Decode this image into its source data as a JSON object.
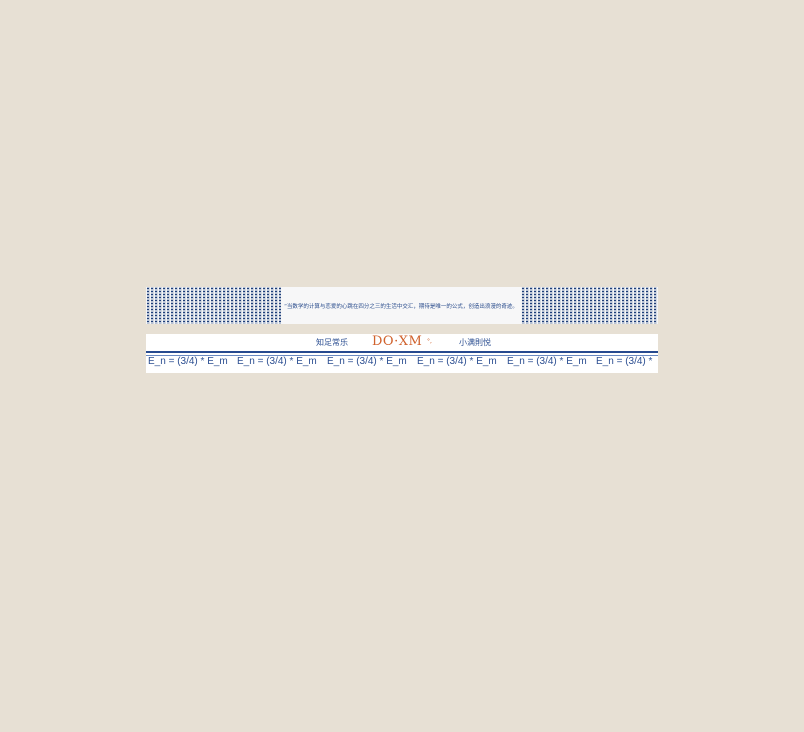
{
  "banner": {
    "quote": "“当数学的计算与恋爱的心跳在四分之三的生活中交汇，期待是唯一的公式，创造出浪漫的奇迹。"
  },
  "header": {
    "slogan_left": "知足常乐",
    "logo": "DO·XM",
    "logo_mark": "°,",
    "slogan_right": "小满則悦"
  },
  "formula_strip": {
    "items": [
      "E_n = (3/4) * E_m",
      "E_n = (3/4) * E_m",
      "E_n = (3/4) * E_m",
      "E_n = (3/4) * E_m",
      "E_n = (3/4) * E_m",
      "E_n = (3/4) *"
    ]
  },
  "colors": {
    "background": "#e7e0d4",
    "primary_blue": "#2b4e91",
    "logo_orange": "#d0612c",
    "card": "#ffffff"
  }
}
